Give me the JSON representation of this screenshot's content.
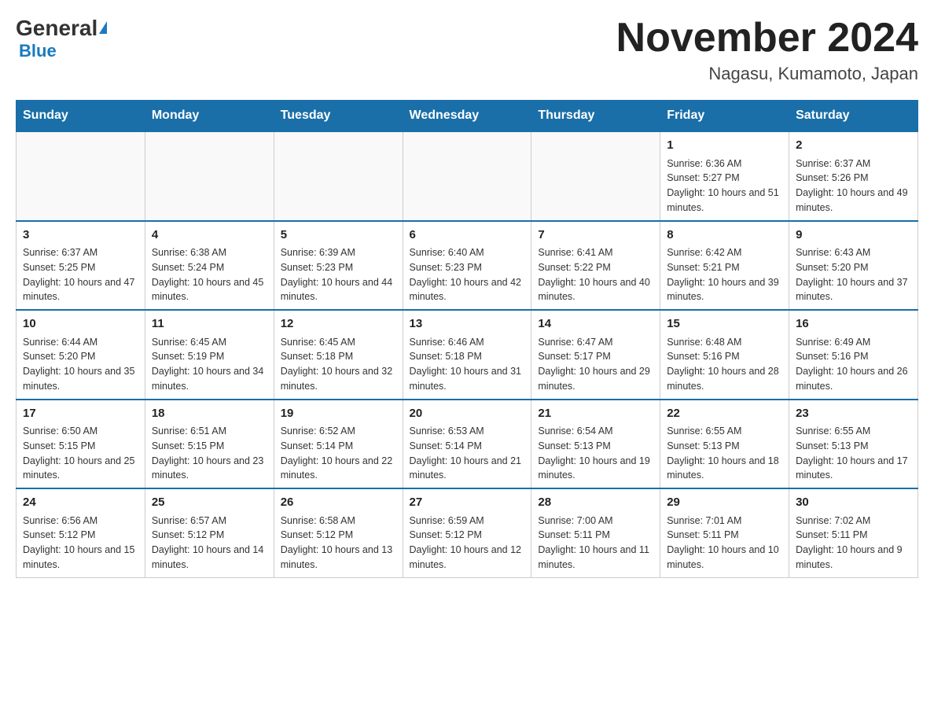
{
  "header": {
    "logo_general": "General",
    "logo_blue": "Blue",
    "month_year": "November 2024",
    "location": "Nagasu, Kumamoto, Japan"
  },
  "days_of_week": [
    "Sunday",
    "Monday",
    "Tuesday",
    "Wednesday",
    "Thursday",
    "Friday",
    "Saturday"
  ],
  "weeks": [
    {
      "days": [
        {
          "num": "",
          "info": ""
        },
        {
          "num": "",
          "info": ""
        },
        {
          "num": "",
          "info": ""
        },
        {
          "num": "",
          "info": ""
        },
        {
          "num": "",
          "info": ""
        },
        {
          "num": "1",
          "info": "Sunrise: 6:36 AM\nSunset: 5:27 PM\nDaylight: 10 hours and 51 minutes."
        },
        {
          "num": "2",
          "info": "Sunrise: 6:37 AM\nSunset: 5:26 PM\nDaylight: 10 hours and 49 minutes."
        }
      ]
    },
    {
      "days": [
        {
          "num": "3",
          "info": "Sunrise: 6:37 AM\nSunset: 5:25 PM\nDaylight: 10 hours and 47 minutes."
        },
        {
          "num": "4",
          "info": "Sunrise: 6:38 AM\nSunset: 5:24 PM\nDaylight: 10 hours and 45 minutes."
        },
        {
          "num": "5",
          "info": "Sunrise: 6:39 AM\nSunset: 5:23 PM\nDaylight: 10 hours and 44 minutes."
        },
        {
          "num": "6",
          "info": "Sunrise: 6:40 AM\nSunset: 5:23 PM\nDaylight: 10 hours and 42 minutes."
        },
        {
          "num": "7",
          "info": "Sunrise: 6:41 AM\nSunset: 5:22 PM\nDaylight: 10 hours and 40 minutes."
        },
        {
          "num": "8",
          "info": "Sunrise: 6:42 AM\nSunset: 5:21 PM\nDaylight: 10 hours and 39 minutes."
        },
        {
          "num": "9",
          "info": "Sunrise: 6:43 AM\nSunset: 5:20 PM\nDaylight: 10 hours and 37 minutes."
        }
      ]
    },
    {
      "days": [
        {
          "num": "10",
          "info": "Sunrise: 6:44 AM\nSunset: 5:20 PM\nDaylight: 10 hours and 35 minutes."
        },
        {
          "num": "11",
          "info": "Sunrise: 6:45 AM\nSunset: 5:19 PM\nDaylight: 10 hours and 34 minutes."
        },
        {
          "num": "12",
          "info": "Sunrise: 6:45 AM\nSunset: 5:18 PM\nDaylight: 10 hours and 32 minutes."
        },
        {
          "num": "13",
          "info": "Sunrise: 6:46 AM\nSunset: 5:18 PM\nDaylight: 10 hours and 31 minutes."
        },
        {
          "num": "14",
          "info": "Sunrise: 6:47 AM\nSunset: 5:17 PM\nDaylight: 10 hours and 29 minutes."
        },
        {
          "num": "15",
          "info": "Sunrise: 6:48 AM\nSunset: 5:16 PM\nDaylight: 10 hours and 28 minutes."
        },
        {
          "num": "16",
          "info": "Sunrise: 6:49 AM\nSunset: 5:16 PM\nDaylight: 10 hours and 26 minutes."
        }
      ]
    },
    {
      "days": [
        {
          "num": "17",
          "info": "Sunrise: 6:50 AM\nSunset: 5:15 PM\nDaylight: 10 hours and 25 minutes."
        },
        {
          "num": "18",
          "info": "Sunrise: 6:51 AM\nSunset: 5:15 PM\nDaylight: 10 hours and 23 minutes."
        },
        {
          "num": "19",
          "info": "Sunrise: 6:52 AM\nSunset: 5:14 PM\nDaylight: 10 hours and 22 minutes."
        },
        {
          "num": "20",
          "info": "Sunrise: 6:53 AM\nSunset: 5:14 PM\nDaylight: 10 hours and 21 minutes."
        },
        {
          "num": "21",
          "info": "Sunrise: 6:54 AM\nSunset: 5:13 PM\nDaylight: 10 hours and 19 minutes."
        },
        {
          "num": "22",
          "info": "Sunrise: 6:55 AM\nSunset: 5:13 PM\nDaylight: 10 hours and 18 minutes."
        },
        {
          "num": "23",
          "info": "Sunrise: 6:55 AM\nSunset: 5:13 PM\nDaylight: 10 hours and 17 minutes."
        }
      ]
    },
    {
      "days": [
        {
          "num": "24",
          "info": "Sunrise: 6:56 AM\nSunset: 5:12 PM\nDaylight: 10 hours and 15 minutes."
        },
        {
          "num": "25",
          "info": "Sunrise: 6:57 AM\nSunset: 5:12 PM\nDaylight: 10 hours and 14 minutes."
        },
        {
          "num": "26",
          "info": "Sunrise: 6:58 AM\nSunset: 5:12 PM\nDaylight: 10 hours and 13 minutes."
        },
        {
          "num": "27",
          "info": "Sunrise: 6:59 AM\nSunset: 5:12 PM\nDaylight: 10 hours and 12 minutes."
        },
        {
          "num": "28",
          "info": "Sunrise: 7:00 AM\nSunset: 5:11 PM\nDaylight: 10 hours and 11 minutes."
        },
        {
          "num": "29",
          "info": "Sunrise: 7:01 AM\nSunset: 5:11 PM\nDaylight: 10 hours and 10 minutes."
        },
        {
          "num": "30",
          "info": "Sunrise: 7:02 AM\nSunset: 5:11 PM\nDaylight: 10 hours and 9 minutes."
        }
      ]
    }
  ]
}
